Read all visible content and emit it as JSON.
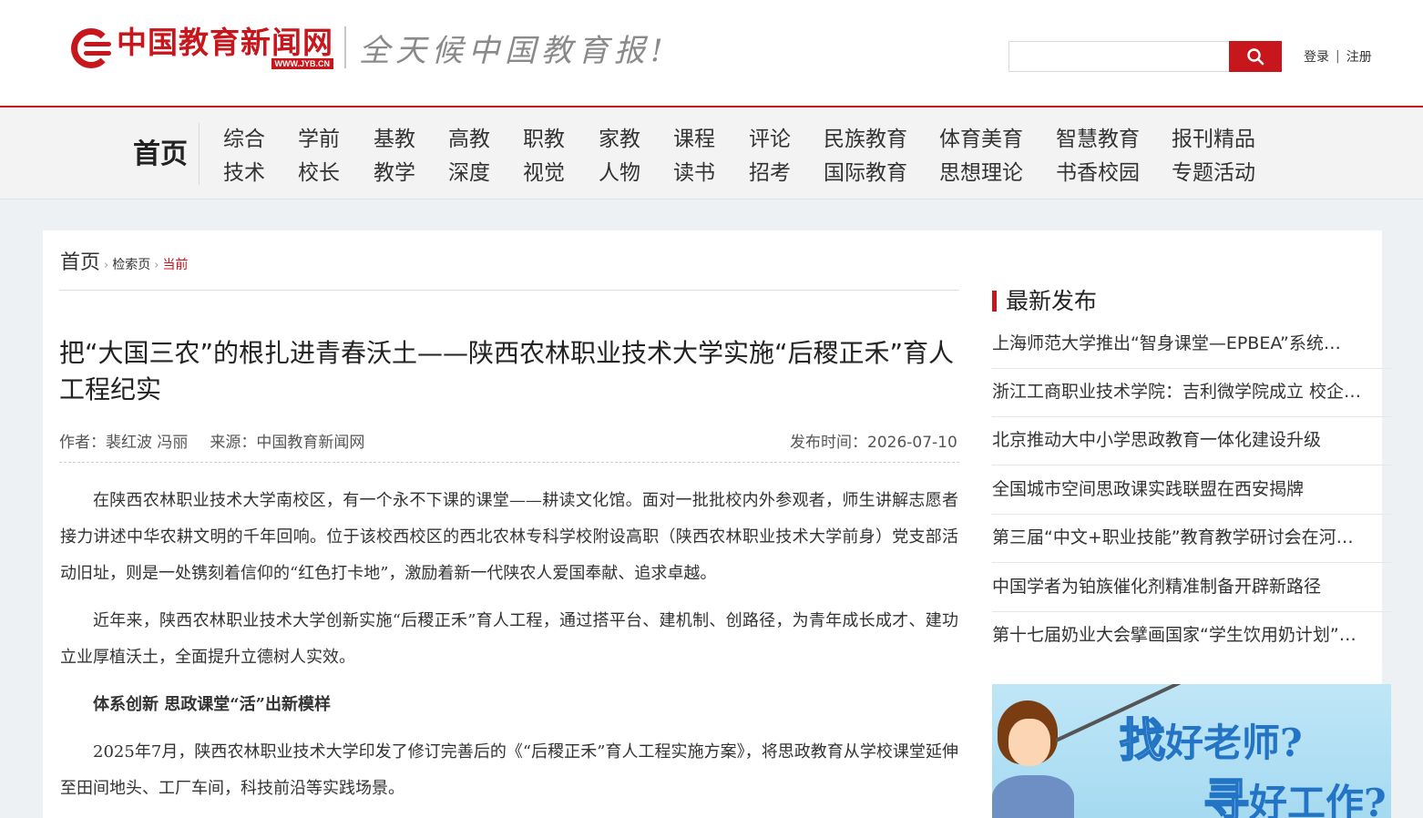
{
  "header": {
    "logo_name": "中国教育新闻网",
    "logo_url": "WWW.JYB.CN",
    "slogan": "全天候中国教育报!",
    "search_placeholder": "",
    "login": "登录",
    "auth_sep": "|",
    "register": "注册"
  },
  "nav": {
    "home": "首页",
    "items": [
      {
        "top": "综合",
        "bottom": "技术"
      },
      {
        "top": "学前",
        "bottom": "校长"
      },
      {
        "top": "基教",
        "bottom": "教学"
      },
      {
        "top": "高教",
        "bottom": "深度"
      },
      {
        "top": "职教",
        "bottom": "视觉"
      },
      {
        "top": "家教",
        "bottom": "人物"
      },
      {
        "top": "课程",
        "bottom": "读书"
      },
      {
        "top": "评论",
        "bottom": "招考"
      },
      {
        "top": "民族教育",
        "bottom": "国际教育"
      },
      {
        "top": "体育美育",
        "bottom": "思想理论"
      },
      {
        "top": "智慧教育",
        "bottom": "书香校园"
      },
      {
        "top": "报刊精品",
        "bottom": "专题活动"
      }
    ]
  },
  "breadcrumb": {
    "home": "首页",
    "sep": "›",
    "search": "检索页",
    "current": "当前"
  },
  "article": {
    "title": "把“大国三农”的根扎进青春沃土——陕西农林职业技术大学实施“后稷正禾”育人工程纪实",
    "author": "作者：裴红波 冯丽",
    "source": "来源：中国教育新闻网",
    "published": "发布时间：2026-07-10",
    "paragraphs": [
      "在陕西农林职业技术大学南校区，有一个永不下课的课堂——耕读文化馆。面对一批批校内外参观者，师生讲解志愿者接力讲述中华农耕文明的千年回响。位于该校西校区的西北农林专科学校附设高职（陕西农林职业技术大学前身）党支部活动旧址，则是一处镌刻着信仰的“红色打卡地”，激励着新一代陕农人爱国奉献、追求卓越。",
      "近年来，陕西农林职业技术大学创新实施“后稷正禾”育人工程，通过搭平台、建机制、创路径，为青年成长成才、建功立业厚植沃土，全面提升立德树人实效。",
      "2025年7月，陕西农林职业技术大学印发了修订完善后的《“后稷正禾”育人工程实施方案》，将思政教育从学校课堂延伸至田间地头、工厂车间，科技前沿等实践场景。"
    ],
    "subheading": "体系创新 思政课堂“活”出新模样"
  },
  "sidebar": {
    "title": "最新发布",
    "items": [
      "上海师范大学推出“智身课堂—EPBEA”系统…",
      "浙江工商职业技术学院：吉利微学院成立 校企…",
      "北京推动大中小学思政教育一体化建设升级",
      "全国城市空间思政课实践联盟在西安揭牌",
      "第三届“中文+职业技能”教育教学研讨会在河…",
      "中国学者为铂族催化剂精准制备开辟新路径",
      "第十七届奶业大会擘画国家“学生饮用奶计划”…"
    ]
  },
  "ad": {
    "line1_big": "找",
    "line1_rest": "好老师?",
    "line2_big": "寻",
    "line2_rest": "好工作?"
  },
  "colors": {
    "brand_red": "#c8161d",
    "ad_blue": "#2374c4"
  }
}
